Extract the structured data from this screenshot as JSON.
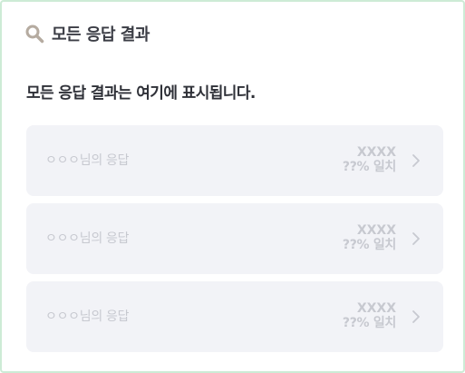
{
  "header": {
    "title": "모든 응답 결과",
    "icon": "search-icon"
  },
  "subtitle": "모든 응답 결과는 여기에 표시됩니다.",
  "colors": {
    "border": "#cdebd6",
    "card_bg": "#f2f3f7",
    "placeholder_text": "#c7c9d0",
    "icon": "#b5aba0"
  },
  "results": [
    {
      "name": "ㅇㅇㅇ님의 응답",
      "code": "XXXX",
      "match": "??% 일치"
    },
    {
      "name": "ㅇㅇㅇ님의 응답",
      "code": "XXXX",
      "match": "??% 일치"
    },
    {
      "name": "ㅇㅇㅇ님의 응답",
      "code": "XXXX",
      "match": "??% 일치"
    }
  ]
}
